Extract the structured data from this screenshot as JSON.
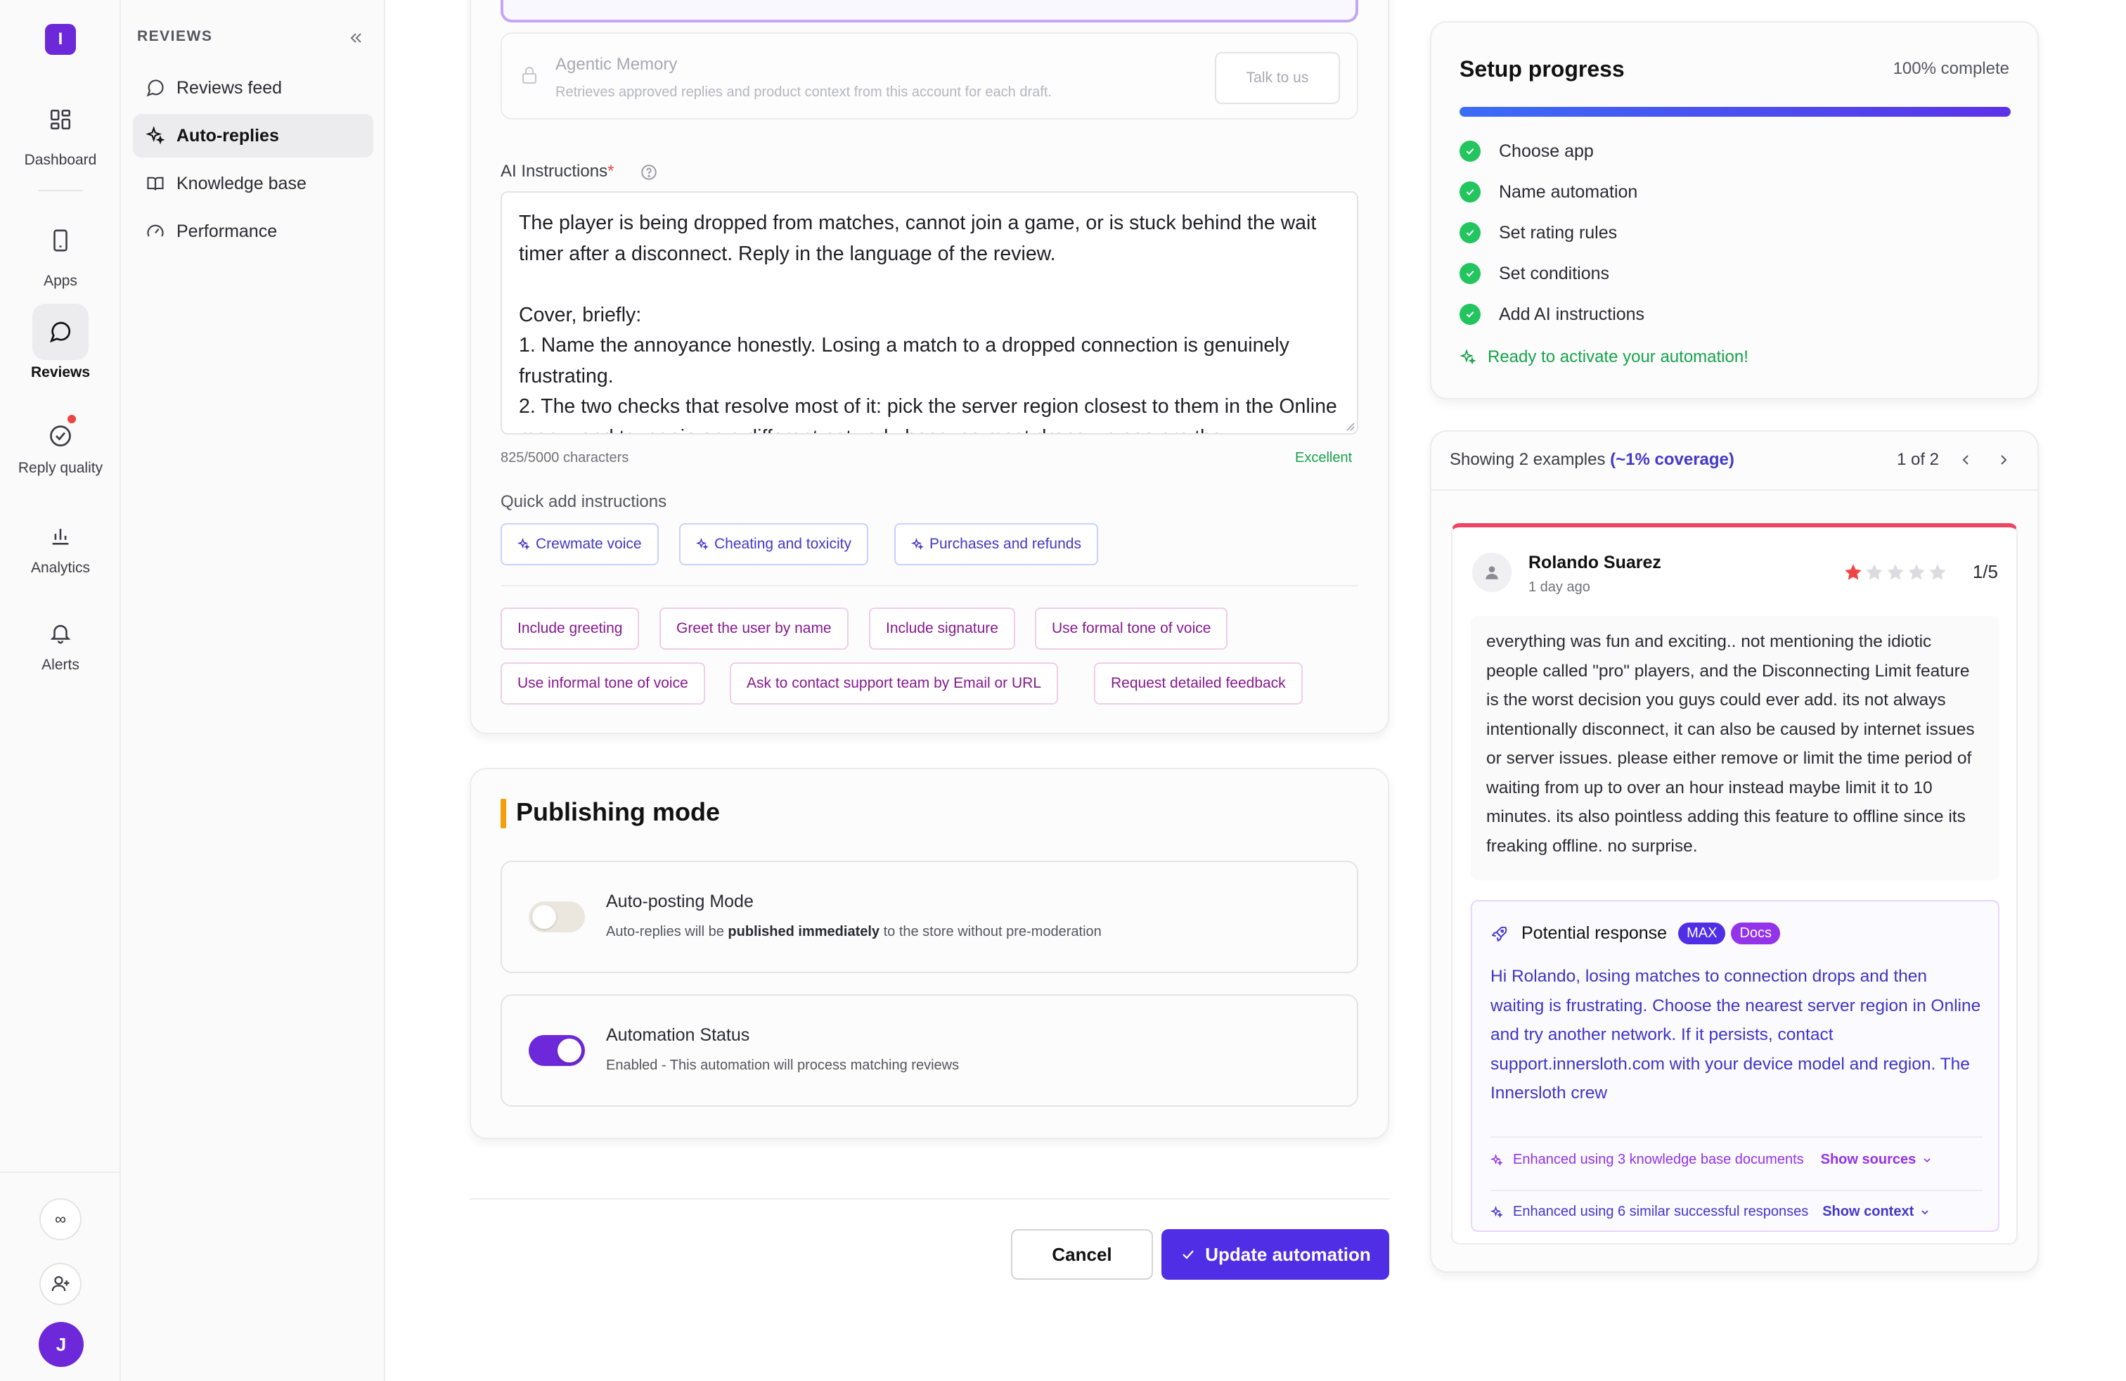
{
  "rail": {
    "logo": "I",
    "items": [
      {
        "label": "Dashboard"
      },
      {
        "label": "Apps"
      },
      {
        "label": "Reviews"
      },
      {
        "label": "Reply quality"
      },
      {
        "label": "Analytics"
      },
      {
        "label": "Alerts"
      }
    ],
    "infinity_label": "∞",
    "avatar": "J"
  },
  "sidebar": {
    "heading": "REVIEWS",
    "items": [
      {
        "label": "Reviews feed",
        "icon": "chat-bubble-icon"
      },
      {
        "label": "Auto-replies",
        "icon": "sparkles-icon",
        "active": true
      },
      {
        "label": "Knowledge base",
        "icon": "book-icon"
      },
      {
        "label": "Performance",
        "icon": "gauge-icon"
      }
    ]
  },
  "memory": {
    "title": "Agentic Memory",
    "description": "Retrieves approved replies and product context from this account for each draft.",
    "talk_button": "Talk to us"
  },
  "instructions": {
    "label": "AI Instructions",
    "required_mark": "*",
    "text": "The player is being dropped from matches, cannot join a game, or is stuck behind the wait timer after a disconnect. Reply in the language of the review.\n\nCover, briefly:\n1. Name the annoyance honestly. Losing a match to a dropped connection is genuinely frustrating.\n2. The two checks that resolve most of it: pick the server region closest to them in the Online menu, and try again on a different network, because most drops we see are the",
    "char_count": "825/5000 characters",
    "quality": "Excellent"
  },
  "quick_add": {
    "label": "Quick add instructions",
    "ai_chips": [
      "Crewmate voice",
      "Cheating and toxicity",
      "Purchases and refunds"
    ],
    "chips_row1": [
      "Include greeting",
      "Greet the user by name",
      "Include signature",
      "Use formal tone of voice"
    ],
    "chips_row2": [
      "Use informal tone of voice",
      "Ask to contact support team by Email or URL",
      "Request detailed feedback"
    ]
  },
  "publishing": {
    "title": "Publishing mode",
    "auto_posting": {
      "title": "Auto-posting Mode",
      "desc_prefix": "Auto-replies will be ",
      "desc_bold": "published immediately",
      "desc_suffix": " to the store without pre-moderation",
      "enabled": false
    },
    "status": {
      "title": "Automation Status",
      "desc": "Enabled - This automation will process matching reviews",
      "enabled": true
    }
  },
  "actions": {
    "cancel": "Cancel",
    "update": "Update automation"
  },
  "setup": {
    "title": "Setup progress",
    "percent_label": "100% complete",
    "progress": 1.0,
    "steps": [
      "Choose app",
      "Name automation",
      "Set rating rules",
      "Set conditions",
      "Add AI instructions"
    ],
    "ready": "Ready to activate your automation!"
  },
  "examples": {
    "showing": "Showing 2 examples ",
    "coverage": "(~1% coverage)",
    "pager": "1 of 2",
    "review": {
      "author": "Rolando Suarez",
      "time": "1 day ago",
      "rating": 1,
      "rating_label": "1/5",
      "body": "everything was fun and exciting.. not mentioning the idiotic people called \"pro\" players, and the Disconnecting Limit feature is the worst decision you guys could ever add. its not always intentionally disconnect, it can also be caused by internet issues or server issues. please either remove or limit the time period of waiting from up to over an hour instead maybe limit it to 10 minutes. its also pointless adding this feature to offline since its freaking offline. no surprise."
    },
    "response": {
      "title": "Potential response",
      "badge_max": "MAX",
      "badge_docs": "Docs",
      "body": "Hi Rolando, losing matches to connection drops and then waiting is frustrating. Choose the nearest server region in Online and try another network. If it persists, contact support.innersloth.com with your device model and region. The Innersloth crew",
      "kb_note": "Enhanced using 3 knowledge base documents",
      "kb_link": "Show sources",
      "sim_note": "Enhanced using 6 similar successful responses",
      "sim_link": "Show context"
    }
  },
  "colors": {
    "brand": "#6d28d9",
    "primary_button": "#4f2ee6",
    "success": "#22c55e",
    "star": "#ef4444"
  }
}
